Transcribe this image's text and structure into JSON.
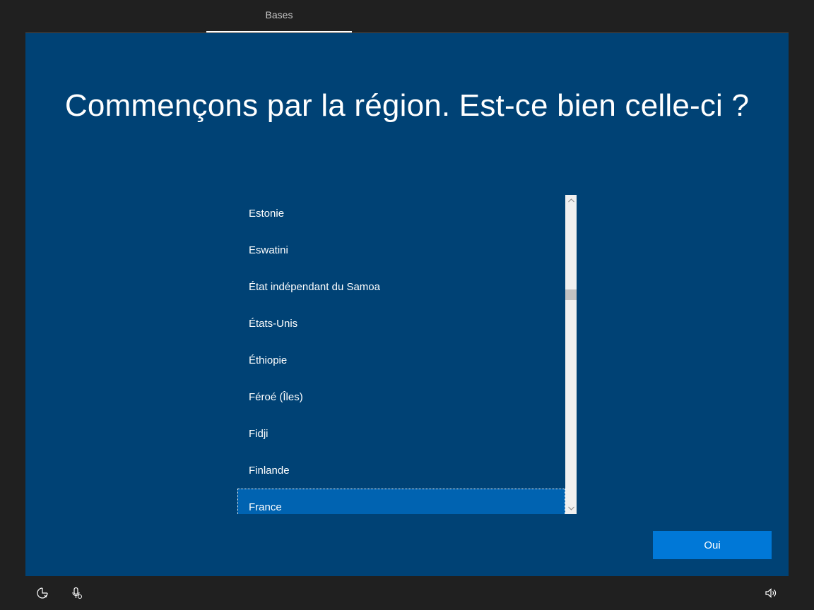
{
  "header": {
    "tab_label": "Bases"
  },
  "main": {
    "headline": "Commençons par la région. Est-ce bien celle-ci ?",
    "region_list": {
      "items": [
        {
          "label": "Estonie"
        },
        {
          "label": "Eswatini"
        },
        {
          "label": "État indépendant du Samoa"
        },
        {
          "label": "États-Unis"
        },
        {
          "label": "Éthiopie"
        },
        {
          "label": "Féroé (Îles)"
        },
        {
          "label": "Fidji"
        },
        {
          "label": "Finlande"
        },
        {
          "label": "France"
        }
      ],
      "selected": "France"
    },
    "confirm_button_label": "Oui"
  },
  "footer": {
    "icons": [
      "accessibility-icon",
      "microphone-icon",
      "volume-icon"
    ]
  },
  "colors": {
    "background_dark": "#202020",
    "panel_blue": "#004275",
    "selection_blue": "#0063b1",
    "accent_button": "#0078d7"
  }
}
